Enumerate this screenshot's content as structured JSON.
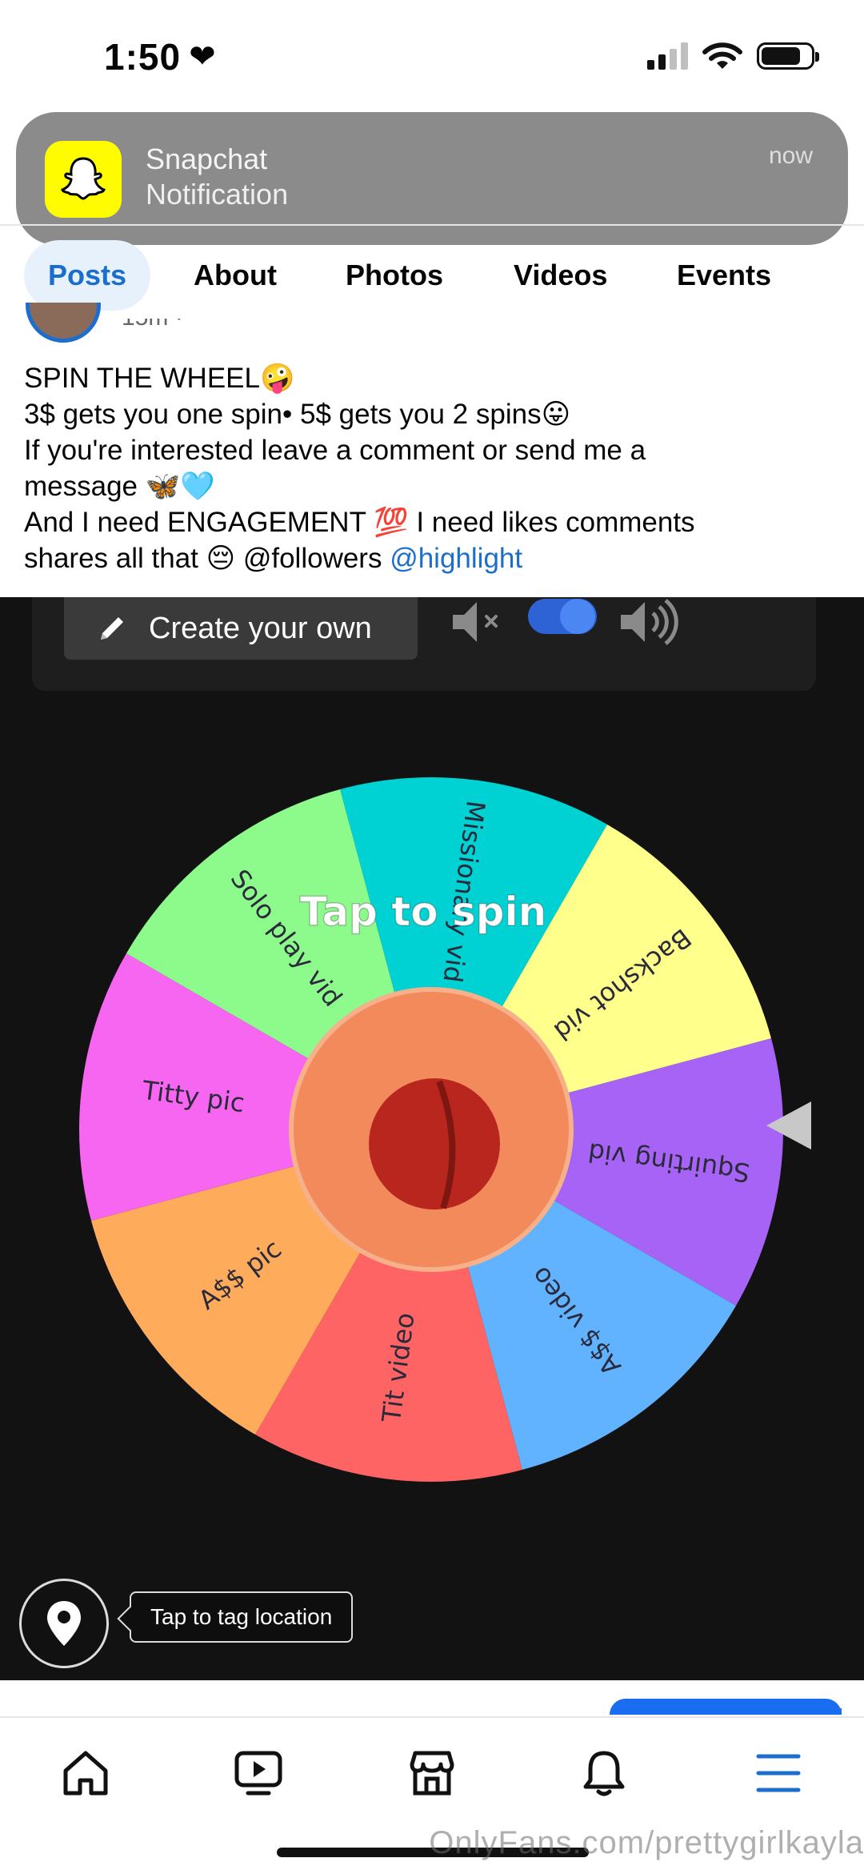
{
  "status_bar": {
    "time": "1:50"
  },
  "notification": {
    "app": "Snapchat",
    "text": "Notification",
    "time": "now"
  },
  "tabs": [
    {
      "label": "Posts",
      "active": true
    },
    {
      "label": "About"
    },
    {
      "label": "Photos"
    },
    {
      "label": "Videos"
    },
    {
      "label": "Events"
    }
  ],
  "post": {
    "meta": "15m ·",
    "lines": [
      "SPIN THE WHEEL🤪",
      "3$ gets you one spin• 5$ gets you 2 spins😛",
      "If you're interested leave a comment or send me a",
      "message 🦋🩵",
      "And I need ENGAGEMENT 💯 I need likes comments"
    ],
    "last_line_text": "shares all that 😔 @followers ",
    "last_line_link": "@highlight"
  },
  "wheel": {
    "create_button": "Create your own",
    "tap_label": "Tap to spin",
    "segments": [
      {
        "label": "Missionary vid",
        "color": "#00D2D3"
      },
      {
        "label": "Backshot vid",
        "color": "#FFFF8C"
      },
      {
        "label": "Squirting vid",
        "color": "#A763F6"
      },
      {
        "label": "A$$ video",
        "color": "#61B2FF"
      },
      {
        "label": "Tit video",
        "color": "#FF6464"
      },
      {
        "label": "A$$ pic",
        "color": "#FFAB5C"
      },
      {
        "label": "Titty pic",
        "color": "#F766F0"
      },
      {
        "label": "Solo play vid",
        "color": "#8CFB8C"
      }
    ]
  },
  "location_tooltip": "Tap to tag location",
  "watermark": "OnlyFans.com/prettygirlkayla",
  "bottom_nav": [
    "home-icon",
    "video-icon",
    "marketplace-icon",
    "bell-icon",
    "menu-icon"
  ]
}
